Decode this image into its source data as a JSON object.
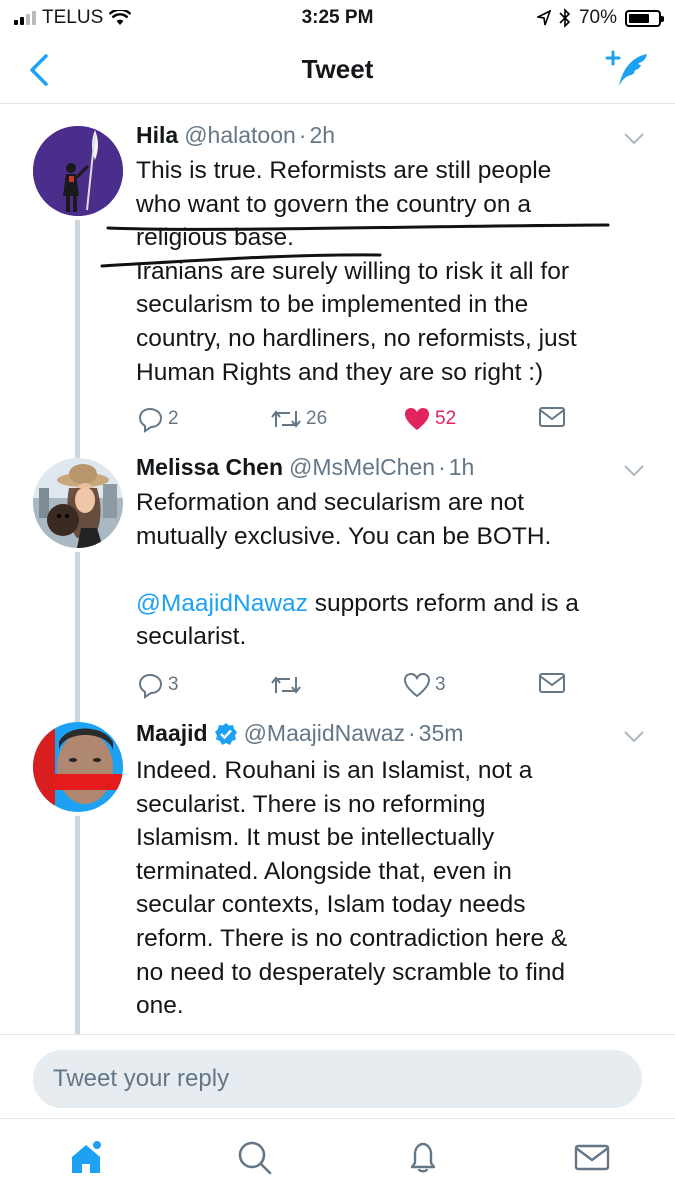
{
  "status_bar": {
    "carrier": "TELUS",
    "time": "3:25 PM",
    "battery": "70%",
    "battery_level": 0.7
  },
  "nav": {
    "title": "Tweet"
  },
  "tweets": [
    {
      "name": "Hila",
      "handle": "@halatoon",
      "time": "2h",
      "text": "This is true. Reformists are still people\nwho want to govern the country on a\nreligious base.\nIranians are surely willing to risk it all for\nsecularism to be implemented in the\ncountry, no hardliners, no reformists, just\nHuman Rights and they are so right :)",
      "replies": "2",
      "retweets": "26",
      "likes": "52",
      "liked": true
    },
    {
      "name": "Melissa Chen",
      "handle": "@MsMelChen",
      "time": "1h",
      "text_1": "Reformation and secularism are not\nmutually exclusive. You can be BOTH.",
      "mention": "@MaajidNawaz",
      "text_2": " supports reform and is a\nsecularist.",
      "replies": "3",
      "retweets": "",
      "likes": "3",
      "liked": false
    },
    {
      "name": "Maajid",
      "verified": true,
      "handle": "@MaajidNawaz",
      "time": "35m",
      "text": "Indeed. Rouhani is an Islamist, not a\nsecularist. There is no reforming\nIslamism. It must be intellectually\nterminated. Alongside that, even in\nsecular contexts, Islam today needs\nreform. There is no contradiction here &\nno need to desperately scramble to find\none."
    }
  ],
  "reply": {
    "placeholder": "Tweet your reply"
  },
  "tabbar": {
    "items": [
      "home-icon",
      "search-icon",
      "notifications-icon",
      "messages-icon"
    ]
  },
  "colors": {
    "accent": "#1da1f2",
    "like": "#e0245e",
    "secondary": "#657786"
  },
  "separators": {
    "dot": "·"
  }
}
